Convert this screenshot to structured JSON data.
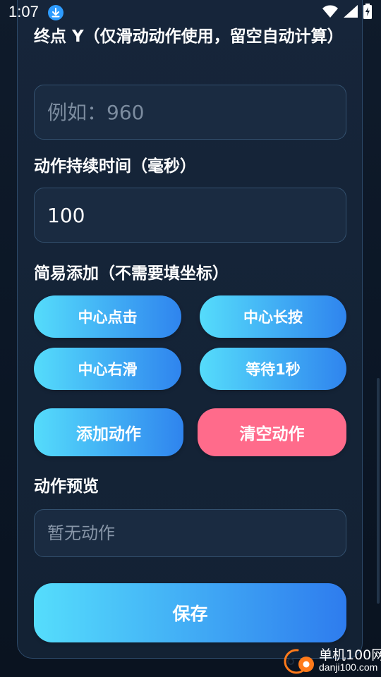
{
  "status_bar": {
    "time": "1:07"
  },
  "form": {
    "end_y": {
      "label": "终点 Y（仅滑动动作使用，留空自动计算）",
      "placeholder": "例如：960",
      "value": ""
    },
    "duration": {
      "label": "动作持续时间（毫秒）",
      "value": "100"
    },
    "quick_add": {
      "label": "简易添加（不需要填坐标）",
      "buttons": [
        "中心点击",
        "中心长按",
        "中心右滑",
        "等待1秒"
      ]
    },
    "actions": {
      "add_label": "添加动作",
      "clear_label": "清空动作"
    },
    "preview": {
      "label": "动作预览",
      "placeholder": "暂无动作"
    },
    "save_label": "保存"
  },
  "watermark": {
    "title": "单机100网",
    "url": "danji100.com"
  },
  "colors": {
    "accent_start": "#55dcfb",
    "accent_end": "#2f84ee",
    "danger": "#ff6b8b",
    "card_border": "#2d4a6a",
    "field_bg": "#1a2b41",
    "page_bg": "#0e1a2a"
  }
}
